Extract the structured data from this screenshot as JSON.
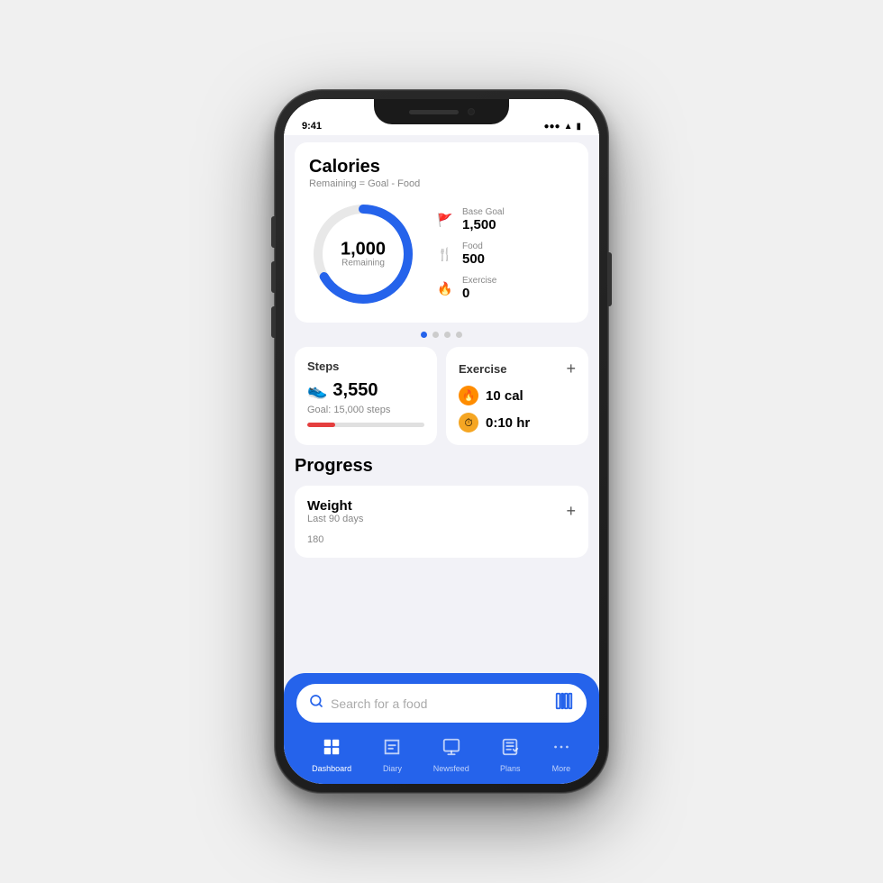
{
  "phone": {
    "statusBar": {
      "time": "9:41",
      "icons": [
        "●●●",
        "WiFi",
        "🔋"
      ]
    }
  },
  "calories": {
    "title": "Calories",
    "subtitle": "Remaining = Goal - Food",
    "remaining_value": "1,000",
    "remaining_label": "Remaining",
    "stats": {
      "base_goal_label": "Base Goal",
      "base_goal_value": "1,500",
      "food_label": "Food",
      "food_value": "500",
      "exercise_label": "Exercise",
      "exercise_value": "0"
    }
  },
  "pagination": {
    "dots": [
      true,
      false,
      false,
      false
    ]
  },
  "steps": {
    "title": "Steps",
    "value": "3,550",
    "goal_text": "Goal: 15,000 steps",
    "progress_percent": 24
  },
  "exercise": {
    "title": "Exercise",
    "calories": "10 cal",
    "duration": "0:10 hr"
  },
  "progress": {
    "heading": "Progress"
  },
  "weight": {
    "title": "Weight",
    "subtitle": "Last 90 days",
    "value_label": "180"
  },
  "search": {
    "placeholder": "Search for a food"
  },
  "tabs": [
    {
      "label": "Dashboard",
      "active": true
    },
    {
      "label": "Diary",
      "active": false
    },
    {
      "label": "Newsfeed",
      "active": false
    },
    {
      "label": "Plans",
      "active": false
    },
    {
      "label": "More",
      "active": false
    }
  ]
}
